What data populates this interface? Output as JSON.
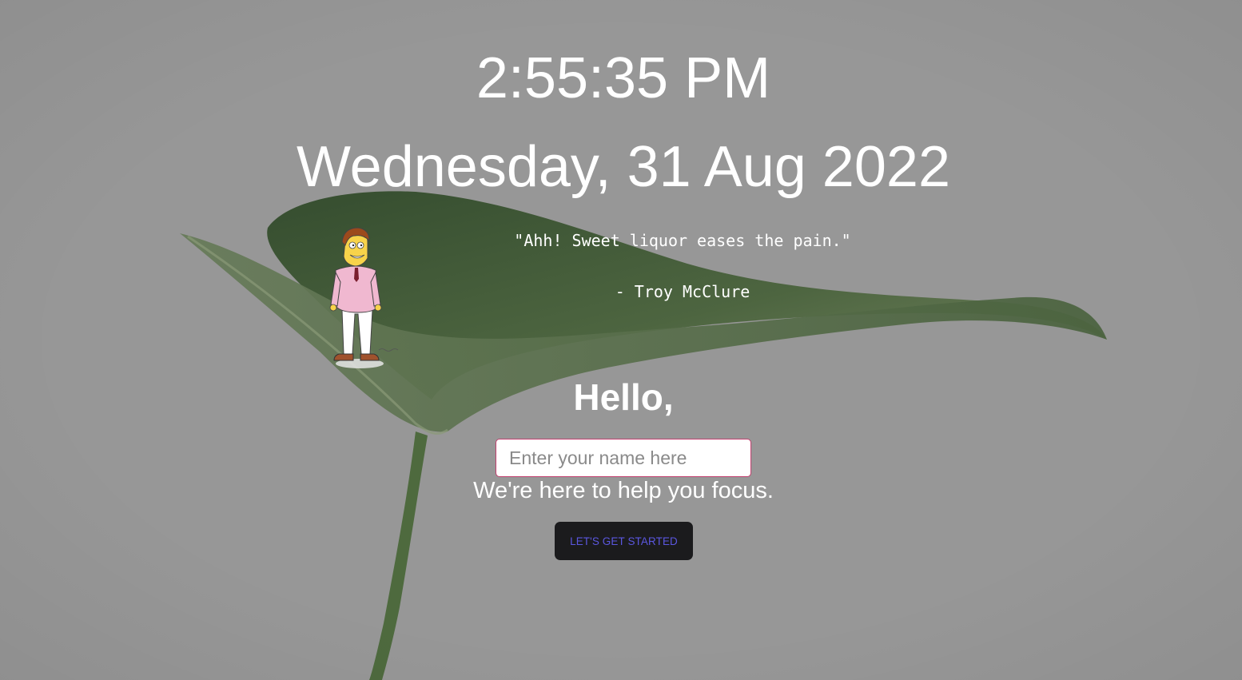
{
  "clock": {
    "time": "2:55:35 PM"
  },
  "date": {
    "text": "Wednesday, 31 Aug 2022"
  },
  "quote": {
    "text": "\"Ahh! Sweet liquor eases the pain.\"",
    "author": "- Troy McClure"
  },
  "greeting": {
    "text": "Hello,"
  },
  "name_input": {
    "placeholder": "Enter your name here",
    "value": ""
  },
  "tagline": {
    "text": "We're here to help you focus."
  },
  "start_button": {
    "label": "LET'S GET STARTED"
  },
  "colors": {
    "background_gray": "#979797",
    "leaf_green": "#3f5a35",
    "input_border": "#c2406f",
    "button_bg": "#1b1b1d",
    "button_text": "#5b57e0"
  },
  "icons": {
    "background": "leaf-photo",
    "character": "troy-mcclure-figure"
  }
}
